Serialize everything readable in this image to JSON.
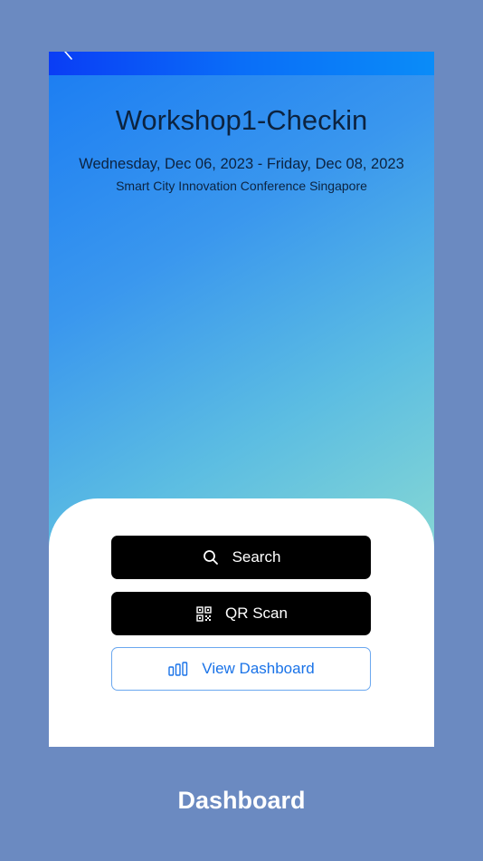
{
  "event": {
    "title": "Workshop1-Checkin",
    "dates": "Wednesday, Dec 06, 2023 - Friday, Dec 08, 2023",
    "conference": "Smart City Innovation Conference Singapore"
  },
  "actions": {
    "search_label": "Search",
    "qr_label": "QR Scan",
    "dashboard_label": "View Dashboard"
  },
  "icons": {
    "back": "chevron-left-icon",
    "search": "search-icon",
    "qr": "qr-code-icon",
    "dashboard": "bar-chart-icon"
  },
  "caption": "Dashboard",
  "colors": {
    "background": "#6b8ac1",
    "topbar": "#0a6ef8",
    "button_dark": "#000000",
    "button_outline_text": "#1a73e8"
  }
}
